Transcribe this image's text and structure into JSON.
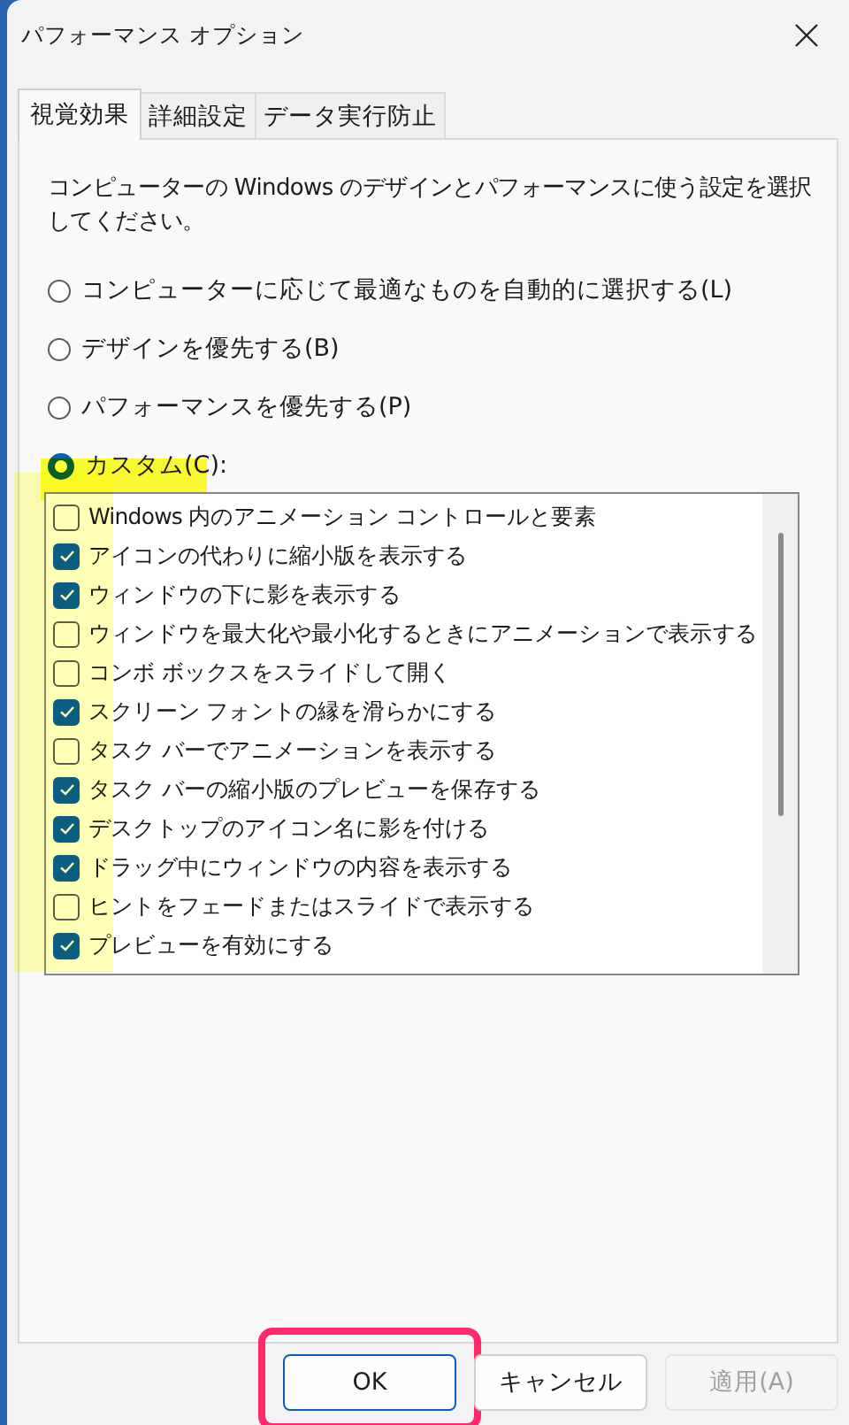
{
  "window": {
    "title": "パフォーマンス オプション"
  },
  "tabs": [
    {
      "label": "視覚効果",
      "selected": true
    },
    {
      "label": "詳細設定",
      "selected": false
    },
    {
      "label": "データ実行防止",
      "selected": false
    }
  ],
  "description": "コンピューターの Windows のデザインとパフォーマンスに使う設定を選択してください。",
  "radios": [
    {
      "label": "コンピューターに応じて最適なものを自動的に選択する(L)",
      "selected": false,
      "highlighted": false
    },
    {
      "label": "デザインを優先する(B)",
      "selected": false,
      "highlighted": false
    },
    {
      "label": "パフォーマンスを優先する(P)",
      "selected": false,
      "highlighted": false
    },
    {
      "label": "カスタム(C):",
      "selected": true,
      "highlighted": true
    }
  ],
  "option_list": {
    "highlighted": true,
    "items": [
      {
        "label": "Windows 内のアニメーション コントロールと要素",
        "checked": false
      },
      {
        "label": "アイコンの代わりに縮小版を表示する",
        "checked": true
      },
      {
        "label": "ウィンドウの下に影を表示する",
        "checked": true
      },
      {
        "label": "ウィンドウを最大化や最小化するときにアニメーションで表示する",
        "checked": false
      },
      {
        "label": "コンボ ボックスをスライドして開く",
        "checked": false
      },
      {
        "label": "スクリーン フォントの縁を滑らかにする",
        "checked": true
      },
      {
        "label": "タスク バーでアニメーションを表示する",
        "checked": false
      },
      {
        "label": "タスク バーの縮小版のプレビューを保存する",
        "checked": true
      },
      {
        "label": "デスクトップのアイコン名に影を付ける",
        "checked": true
      },
      {
        "label": "ドラッグ中にウィンドウの内容を表示する",
        "checked": true
      },
      {
        "label": "ヒントをフェードまたはスライドで表示する",
        "checked": false
      },
      {
        "label": "プレビューを有効にする",
        "checked": true
      }
    ]
  },
  "buttons": [
    {
      "label": "OK",
      "kind": "primary",
      "disabled": false,
      "highlighted": true
    },
    {
      "label": "キャンセル",
      "kind": "normal",
      "disabled": false,
      "highlighted": false
    },
    {
      "label": "適用(A)",
      "kind": "normal",
      "disabled": true,
      "highlighted": false
    }
  ]
}
